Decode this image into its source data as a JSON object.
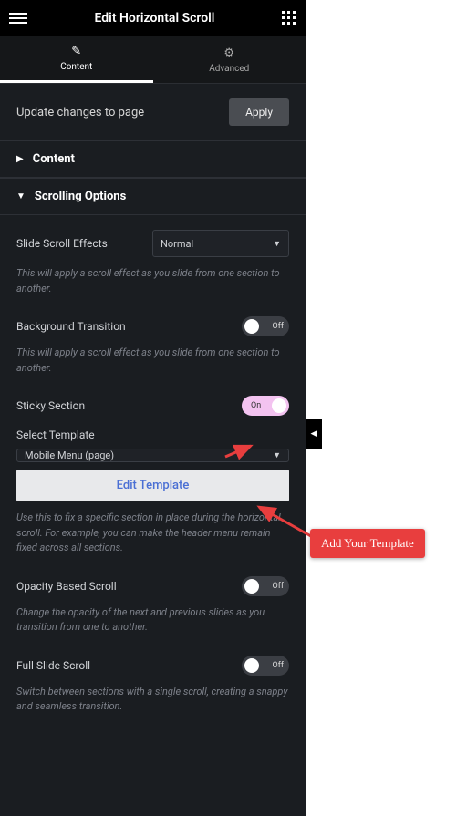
{
  "header": {
    "title": "Edit Horizontal Scroll"
  },
  "tabs": {
    "content": "Content",
    "advanced": "Advanced"
  },
  "update": {
    "label": "Update changes to page",
    "button": "Apply"
  },
  "section_content": {
    "title": "Content"
  },
  "section_scroll": {
    "title": "Scrolling Options",
    "slide_effects_label": "Slide Scroll Effects",
    "slide_effects_value": "Normal",
    "slide_effects_hint": "This will apply a scroll effect as you slide from one section to another.",
    "bg_transition_label": "Background Transition",
    "bg_transition_state": "Off",
    "bg_transition_hint": "This will apply a scroll effect as you slide from one section to another.",
    "sticky_label": "Sticky Section",
    "sticky_state": "On",
    "template_label": "Select Template",
    "template_value": "Mobile Menu (page)",
    "edit_template_btn": "Edit Template",
    "sticky_hint": "Use this to fix a specific section in place during the horizontal scroll. For example, you can make the header menu remain fixed across all sections.",
    "opacity_label": "Opacity Based Scroll",
    "opacity_state": "Off",
    "opacity_hint": "Change the opacity of the next and previous slides as you transition from one to another.",
    "full_label": "Full Slide Scroll",
    "full_state": "Off",
    "full_hint": "Switch between sections with a single scroll, creating a snappy and seamless transition."
  },
  "callout": {
    "text": "Add Your Template"
  }
}
